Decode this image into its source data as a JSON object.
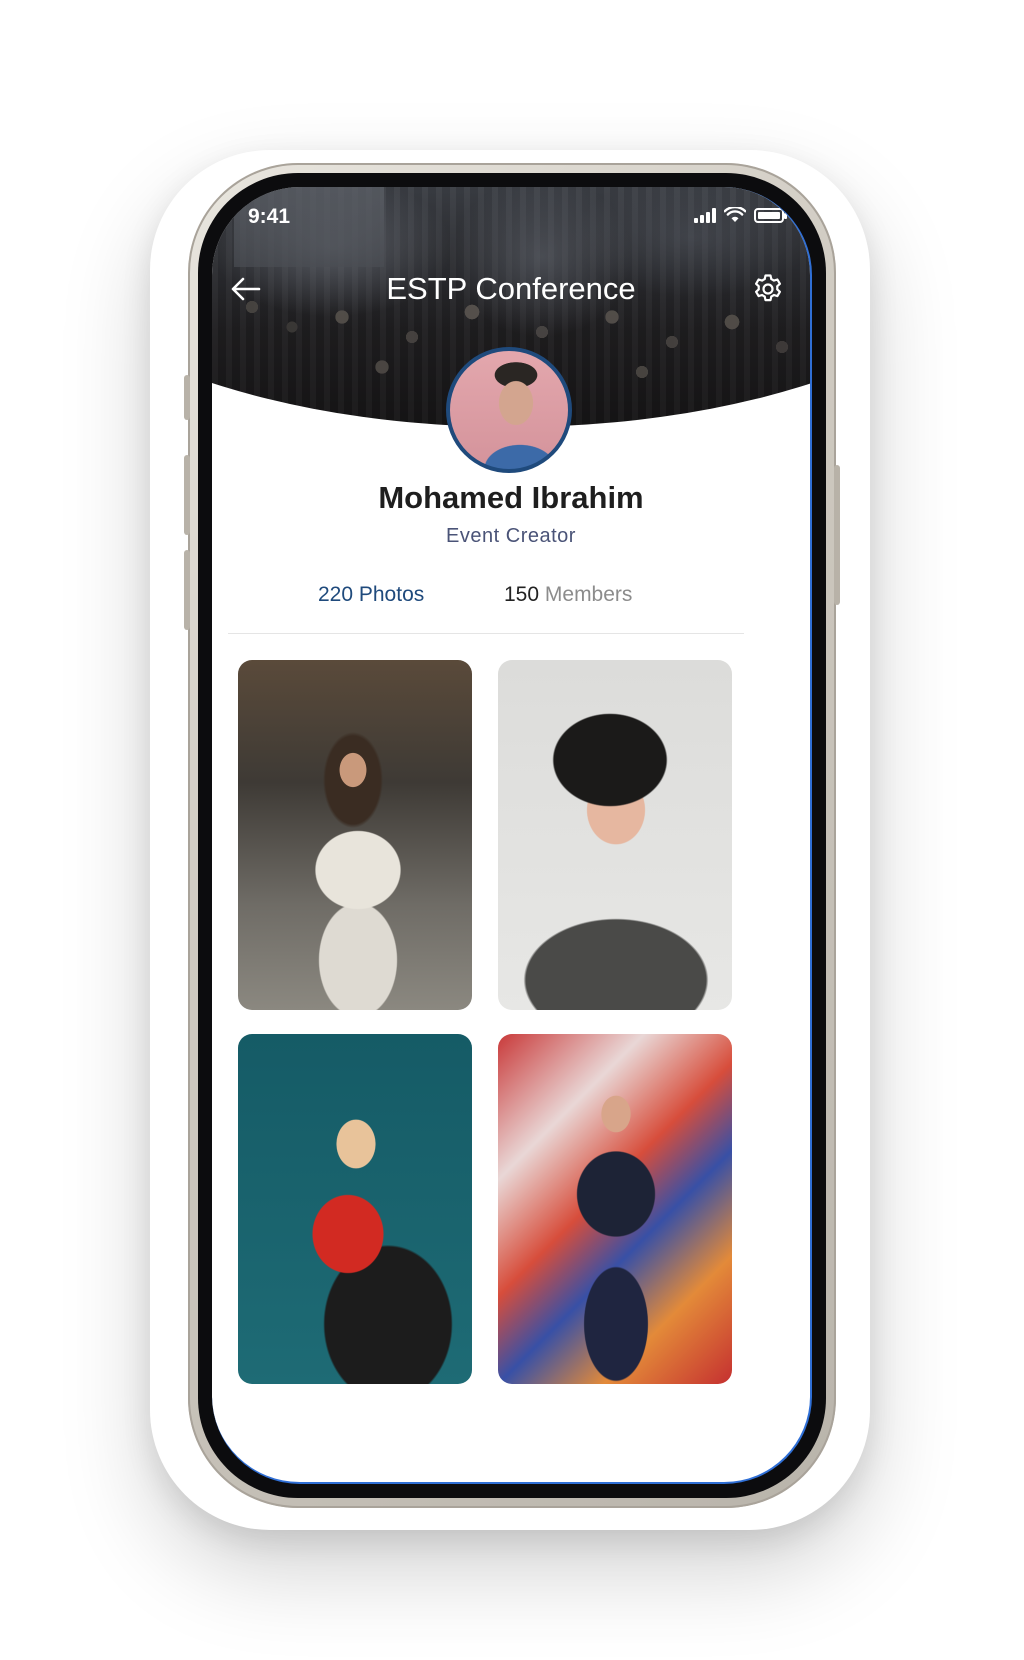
{
  "status_bar": {
    "time": "9:41"
  },
  "header": {
    "title": "ESTP Conference",
    "back_icon": "arrow-left-icon",
    "settings_icon": "gear-icon"
  },
  "profile": {
    "name": "Mohamed Ibrahim",
    "role": "Event Creator"
  },
  "stats": {
    "photos": "220 Photos",
    "members_count": "150",
    "members_label": "Members"
  },
  "colors": {
    "accent": "#1f4a7c",
    "role_text": "#4a5377",
    "screen_edge": "#2f6fd6"
  },
  "gallery": {
    "items": [
      "photo-woman-white-outfit",
      "photo-man-black-hat",
      "photo-woman-red-shirt",
      "photo-woman-graffiti-wall"
    ]
  }
}
